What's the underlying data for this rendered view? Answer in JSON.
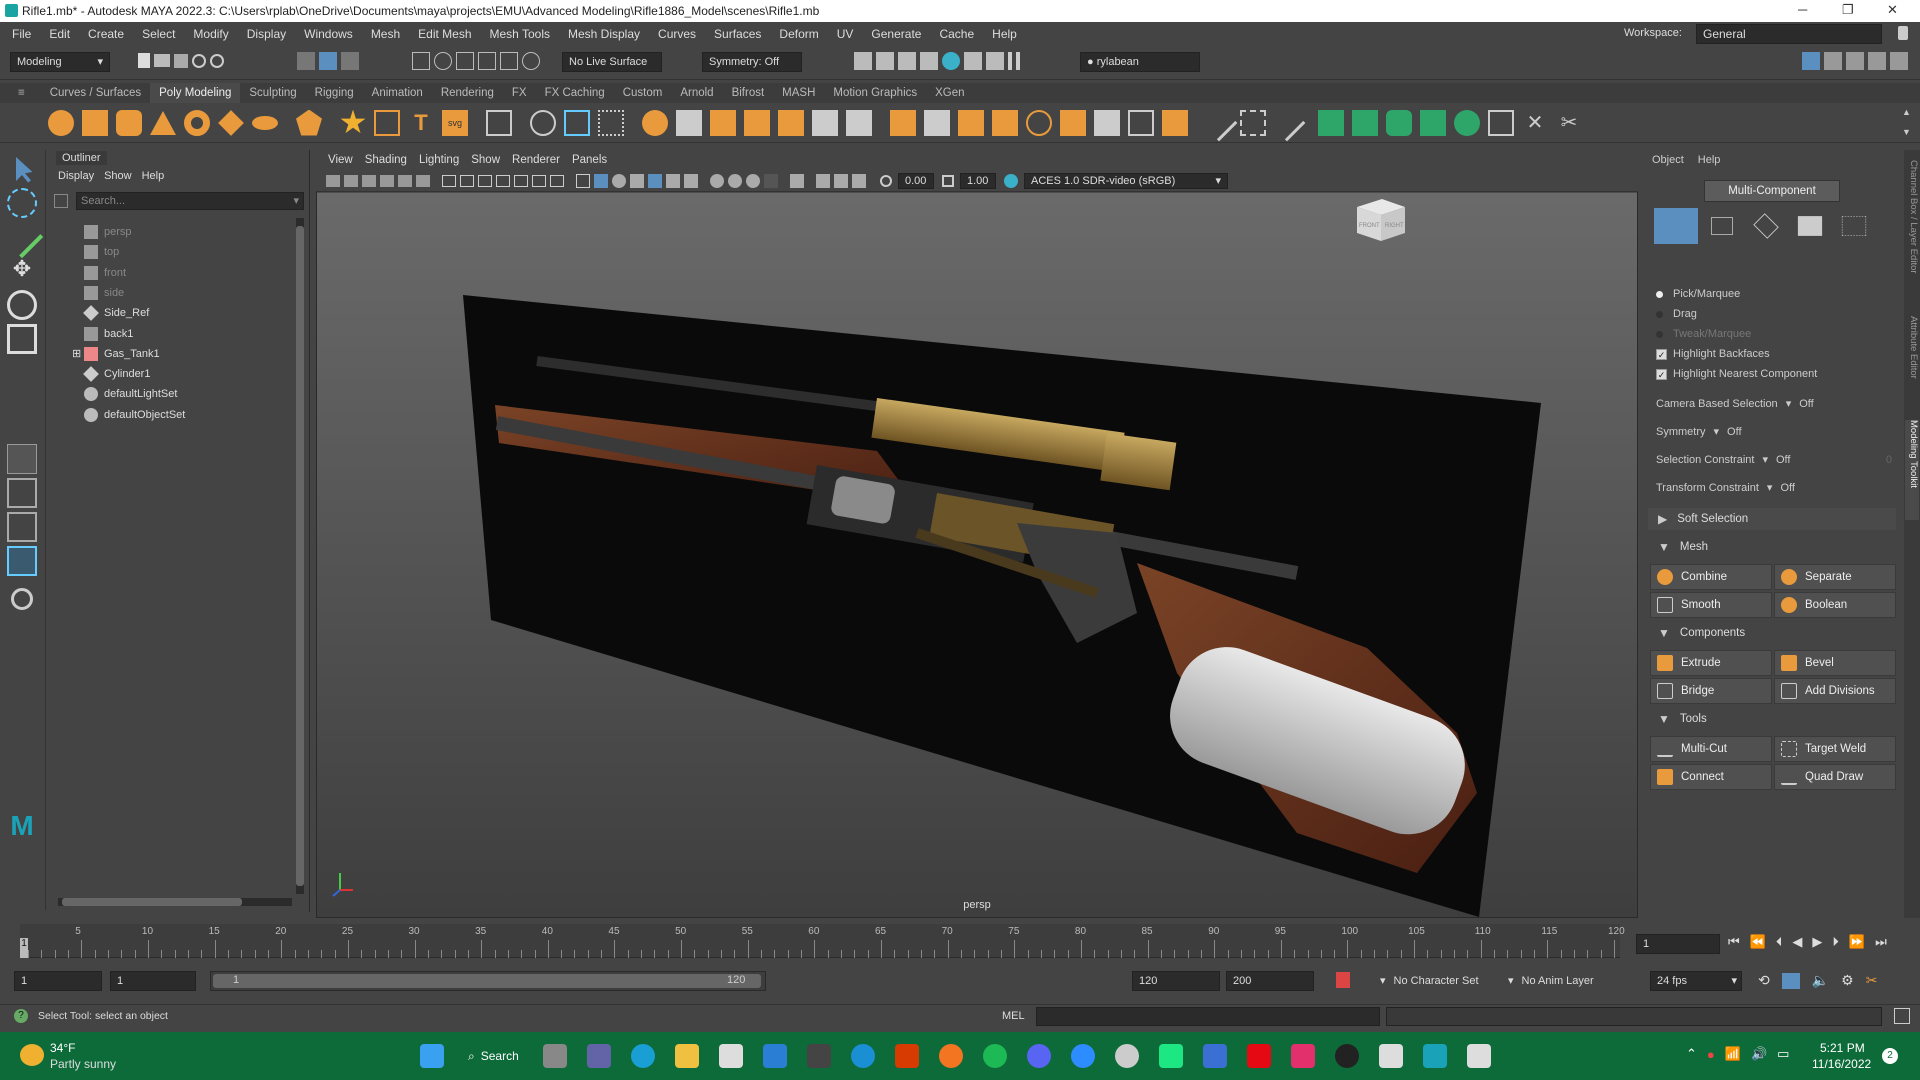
{
  "window": {
    "title": "Rifle1.mb* - Autodesk MAYA 2022.3: C:\\Users\\rplab\\OneDrive\\Documents\\maya\\projects\\EMU\\Advanced Modeling\\Rifle1886_Model\\scenes\\Rifle1.mb",
    "min": "─",
    "max": "❐",
    "close": "✕"
  },
  "menubar": {
    "items": [
      "File",
      "Edit",
      "Create",
      "Select",
      "Modify",
      "Display",
      "Windows",
      "Mesh",
      "Edit Mesh",
      "Mesh Tools",
      "Mesh Display",
      "Curves",
      "Surfaces",
      "Deform",
      "UV",
      "Generate",
      "Cache",
      "Help"
    ],
    "workspace_label": "Workspace:",
    "workspace_value": "General"
  },
  "statusline": {
    "mode": "Modeling",
    "live_surface": "No Live Surface",
    "symmetry": "Symmetry: Off",
    "user": "rylabean"
  },
  "shelf": {
    "tabs": [
      "Curves / Surfaces",
      "Poly Modeling",
      "Sculpting",
      "Rigging",
      "Animation",
      "Rendering",
      "FX",
      "FX Caching",
      "Custom",
      "Arnold",
      "Bifrost",
      "MASH",
      "Motion Graphics",
      "XGen"
    ],
    "active_tab": "Poly Modeling"
  },
  "outliner": {
    "title": "Outliner",
    "menu": [
      "Display",
      "Show",
      "Help"
    ],
    "search_placeholder": "Search...",
    "items": [
      {
        "label": "persp",
        "dim": true,
        "icon": "camera-icon"
      },
      {
        "label": "top",
        "dim": true,
        "icon": "camera-icon"
      },
      {
        "label": "front",
        "dim": true,
        "icon": "camera-icon"
      },
      {
        "label": "side",
        "dim": true,
        "icon": "camera-icon"
      },
      {
        "label": "Side_Ref",
        "dim": false,
        "icon": "transform-icon"
      },
      {
        "label": "back1",
        "dim": false,
        "icon": "camera-icon"
      },
      {
        "label": "Gas_Tank1",
        "dim": false,
        "icon": "group-icon"
      },
      {
        "label": "Cylinder1",
        "dim": false,
        "icon": "transform-icon"
      },
      {
        "label": "defaultLightSet",
        "dim": false,
        "icon": "set-icon"
      },
      {
        "label": "defaultObjectSet",
        "dim": false,
        "icon": "set-icon"
      }
    ]
  },
  "viewport": {
    "menu": [
      "View",
      "Shading",
      "Lighting",
      "Show",
      "Renderer",
      "Panels"
    ],
    "exposure": "0.00",
    "gamma": "1.00",
    "colorspace": "ACES 1.0 SDR-video (sRGB)",
    "camera_label": "persp",
    "viewcube_front": "FRONT",
    "viewcube_right": "RIGHT"
  },
  "modeling_toolkit": {
    "menu": [
      "Object",
      "Help"
    ],
    "mode_button": "Multi-Component",
    "pick_marquee": "Pick/Marquee",
    "drag": "Drag",
    "tweak_marquee": "Tweak/Marquee",
    "highlight_backfaces": "Highlight Backfaces",
    "highlight_nearest": "Highlight Nearest Component",
    "camera_based_selection": {
      "label": "Camera Based Selection",
      "value": "Off"
    },
    "symmetry": {
      "label": "Symmetry",
      "value": "Off"
    },
    "selection_constraint": {
      "label": "Selection Constraint",
      "value": "Off",
      "num": "0"
    },
    "transform_constraint": {
      "label": "Transform Constraint",
      "value": "Off"
    },
    "soft_selection": "Soft Selection",
    "mesh_header": "Mesh",
    "mesh_buttons": [
      "Combine",
      "Separate",
      "Smooth",
      "Boolean"
    ],
    "components_header": "Components",
    "component_buttons": [
      "Extrude",
      "Bevel",
      "Bridge",
      "Add Divisions"
    ],
    "tools_header": "Tools",
    "tool_buttons": [
      "Multi-Cut",
      "Target Weld",
      "Connect",
      "Quad Draw"
    ]
  },
  "edge_tabs": [
    "Channel Box / Layer Editor",
    "Attribute Editor",
    "Modeling Toolkit"
  ],
  "timeline": {
    "ticks": [
      "5",
      "10",
      "15",
      "20",
      "25",
      "30",
      "35",
      "40",
      "45",
      "50",
      "55",
      "60",
      "65",
      "70",
      "75",
      "80",
      "85",
      "90",
      "95",
      "100",
      "105",
      "110",
      "115",
      "120"
    ],
    "current_frame": "1",
    "frame_field": "1"
  },
  "range": {
    "start": "1",
    "inner_start": "1",
    "slider_start": "1",
    "slider_end": "120",
    "end": "120",
    "anim_end": "200",
    "character_set": "No Character Set",
    "anim_layer": "No Anim Layer",
    "fps": "24 fps"
  },
  "cmdline": {
    "help": "Select Tool: select an object",
    "lang": "MEL"
  },
  "taskbar": {
    "temp": "34°F",
    "weather": "Partly sunny",
    "search": "Search",
    "time": "5:21 PM",
    "date": "11/16/2022",
    "notif_count": "2"
  }
}
